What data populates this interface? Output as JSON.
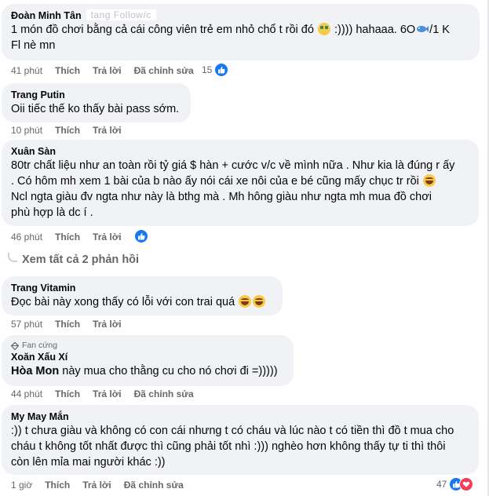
{
  "comments": [
    {
      "author": "Đoàn Minh Tân",
      "author_suffix": "tang Follow/c",
      "text_a": "1 món đồ chơi bằng cả cái công viên trẻ em nhỏ chổ t rồi đó",
      "text_b": ":)))) hahaaa. 6O",
      "text_c": "/1 K",
      "text_d": "Fl nè mn",
      "time": "41 phút",
      "like": "Thích",
      "reply": "Trả lời",
      "edit": "Đã chỉnh sửa",
      "reaction_count": "15"
    },
    {
      "author": "Trang Putin",
      "text": "Oii tiếc thế ko thấy bài pass sớm.",
      "time": "10 phút",
      "like": "Thích",
      "reply": "Trả lời"
    },
    {
      "author": "Xuân Sàn",
      "line1": "80tr chất liệu như an toàn rồi tỷ giá $ hàn + cước v/c về mình nữa . Như kia là đúng r ấy",
      "line2": ". Có hôm mh xem 1 bài của b nào ấy nói cái xe nôi của e bé cũng mấy chục tr rồi",
      "line3": "Ncl ngta giàu đv ngta như này là bthg mà . Mh hông giàu như ngta mh mua đồ chơi",
      "line4": "phù hợp là dc í .",
      "time": "46 phút",
      "like": "Thích",
      "reply": "Trả lời"
    },
    {
      "author": "Trang Vitamin",
      "text": "Đọc bài này xong thấy có lỗi với con trai quá",
      "time": "57 phút",
      "like": "Thích",
      "reply": "Trả lời"
    },
    {
      "badge": "Fan cứng",
      "author": "Xoăn Xấu Xí",
      "mention": "Hòa Mon",
      "text": "này mua cho thằng cu cho nó chơi đi =)))))",
      "time": "44 phút",
      "like": "Thích",
      "reply": "Trả lời",
      "edit": "Đã chỉnh sửa"
    },
    {
      "author": "My May Mắn",
      "line1": ":)) t chưa giàu và không có con cái nhưng t có cháu và lúc nào t có tiền thì đồ t mua cho",
      "line2": "cháu t không tốt nhất được thì cũng phải tốt nhì :))) nghèo hơn không thấy tự ti thì thôi",
      "line3": "còn lên mỉa mai người khác :))",
      "time": "1 giờ",
      "like": "Thích",
      "reply": "Trả lời",
      "edit": "Đã chỉnh sửa",
      "reaction_count": "47"
    }
  ],
  "view_replies": "Xem tất cả 2 phản hồi",
  "icons": {
    "like": "like-icon",
    "heart": "heart-icon",
    "laugh": "laughing-emoji-icon",
    "money": "money-face-emoji-icon",
    "fish": "fish-emoji-icon",
    "fan": "fan-badge-icon"
  },
  "colors": {
    "bubble": "#f0f2f5",
    "secondary_text": "#65676b",
    "like_blue": "#1877f2",
    "heart_red": "#f33e58"
  }
}
